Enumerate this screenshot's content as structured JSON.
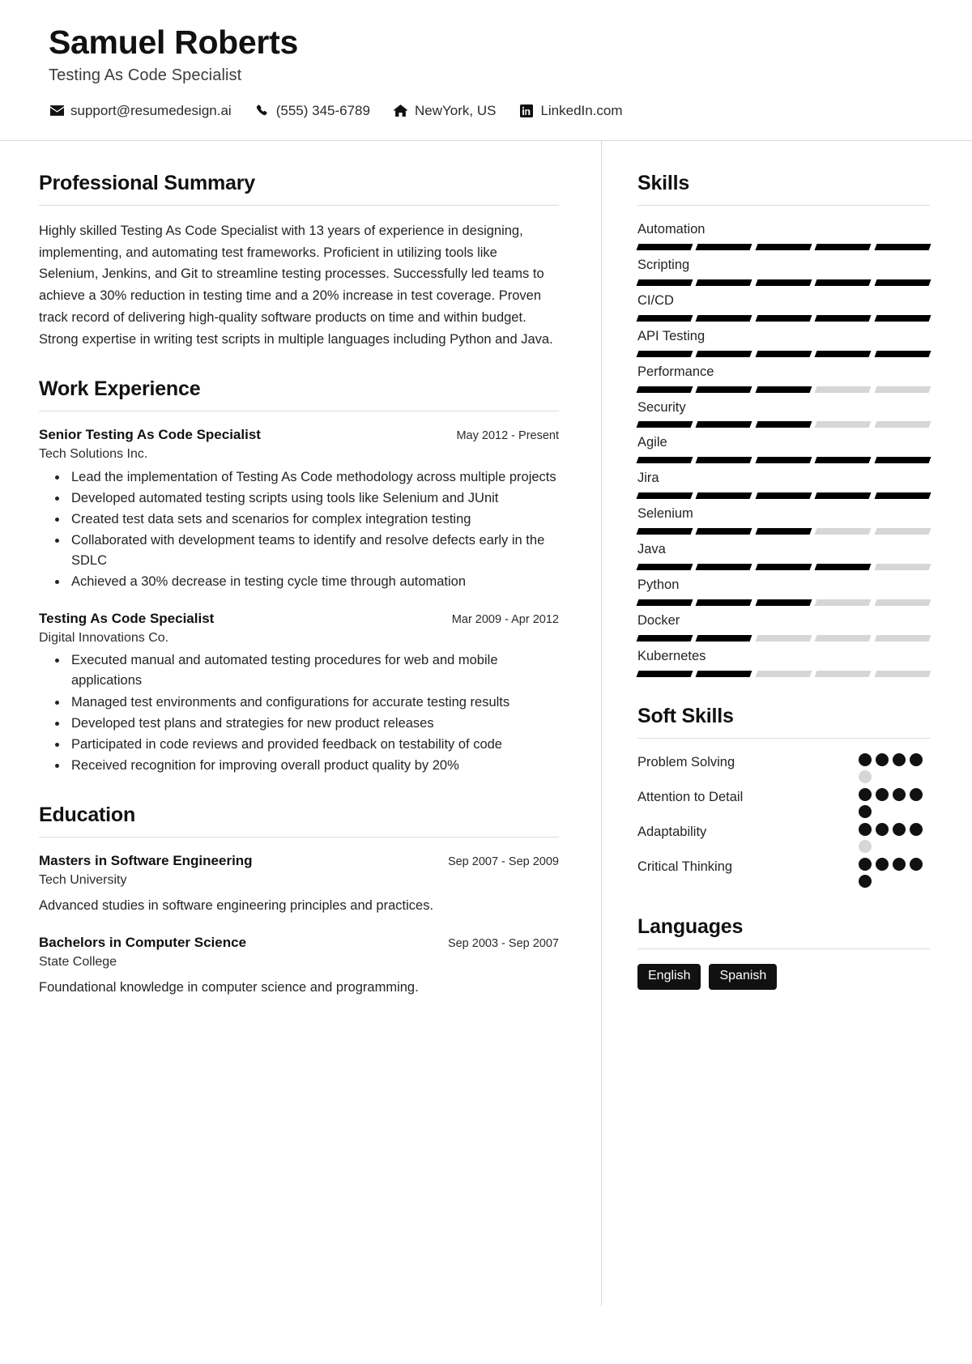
{
  "header": {
    "name": "Samuel Roberts",
    "job_title": "Testing As Code Specialist",
    "contacts": [
      {
        "icon": "envelope-icon",
        "text": "support@resumedesign.ai"
      },
      {
        "icon": "phone-icon",
        "text": "(555) 345-6789"
      },
      {
        "icon": "home-icon",
        "text": "NewYork, US"
      },
      {
        "icon": "linkedin-icon",
        "text": "LinkedIn.com"
      }
    ]
  },
  "main": {
    "summary": {
      "title": "Professional Summary",
      "text": "Highly skilled Testing As Code Specialist with 13 years of experience in designing, implementing, and automating test frameworks. Proficient in utilizing tools like Selenium, Jenkins, and Git to streamline testing processes. Successfully led teams to achieve a 30% reduction in testing time and a 20% increase in test coverage. Proven track record of delivering high-quality software products on time and within budget. Strong expertise in writing test scripts in multiple languages including Python and Java."
    },
    "experience": {
      "title": "Work Experience",
      "entries": [
        {
          "role": "Senior Testing As Code Specialist",
          "date": "May 2012 - Present",
          "company": "Tech Solutions Inc.",
          "bullets": [
            "Lead the implementation of Testing As Code methodology across multiple projects",
            "Developed automated testing scripts using tools like Selenium and JUnit",
            "Created test data sets and scenarios for complex integration testing",
            "Collaborated with development teams to identify and resolve defects early in the SDLC",
            "Achieved a 30% decrease in testing cycle time through automation"
          ]
        },
        {
          "role": "Testing As Code Specialist",
          "date": "Mar 2009 - Apr 2012",
          "company": "Digital Innovations Co.",
          "bullets": [
            "Executed manual and automated testing procedures for web and mobile applications",
            "Managed test environments and configurations for accurate testing results",
            "Developed test plans and strategies for new product releases",
            "Participated in code reviews and provided feedback on testability of code",
            "Received recognition for improving overall product quality by 20%"
          ]
        }
      ]
    },
    "education": {
      "title": "Education",
      "entries": [
        {
          "degree": "Masters in Software Engineering",
          "date": "Sep 2007 - Sep 2009",
          "school": "Tech University",
          "description": "Advanced studies in software engineering principles and practices."
        },
        {
          "degree": "Bachelors in Computer Science",
          "date": "Sep 2003 - Sep 2007",
          "school": "State College",
          "description": "Foundational knowledge in computer science and programming."
        }
      ]
    }
  },
  "sidebar": {
    "skills": {
      "title": "Skills",
      "max_level": 5,
      "items": [
        {
          "name": "Automation",
          "level": 5
        },
        {
          "name": "Scripting",
          "level": 5
        },
        {
          "name": "CI/CD",
          "level": 5
        },
        {
          "name": "API Testing",
          "level": 5
        },
        {
          "name": "Performance",
          "level": 3
        },
        {
          "name": "Security",
          "level": 3
        },
        {
          "name": "Agile",
          "level": 5
        },
        {
          "name": "Jira",
          "level": 5
        },
        {
          "name": "Selenium",
          "level": 3
        },
        {
          "name": "Java",
          "level": 4
        },
        {
          "name": "Python",
          "level": 3
        },
        {
          "name": "Docker",
          "level": 2
        },
        {
          "name": "Kubernetes",
          "level": 2
        }
      ]
    },
    "soft_skills": {
      "title": "Soft Skills",
      "max_level": 5,
      "items": [
        {
          "name": "Problem Solving",
          "level": 4
        },
        {
          "name": "Attention to Detail",
          "level": 5
        },
        {
          "name": "Adaptability",
          "level": 4
        },
        {
          "name": "Critical Thinking",
          "level": 5
        }
      ]
    },
    "languages": {
      "title": "Languages",
      "items": [
        "English",
        "Spanish"
      ]
    }
  },
  "colors": {
    "accent": "#000000",
    "track": "#d6d6d6",
    "rule": "#dcdcdc",
    "text": "#242424"
  }
}
